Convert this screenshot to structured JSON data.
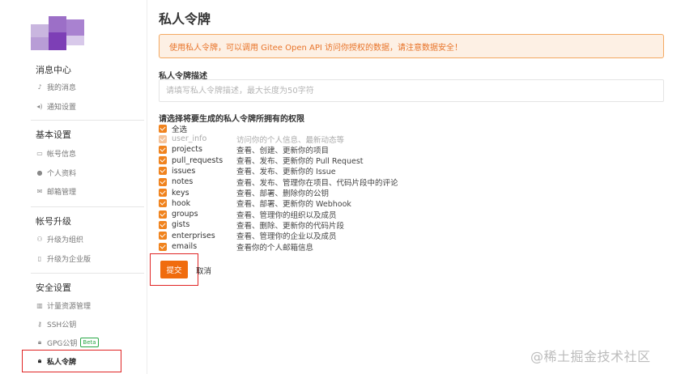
{
  "page_title": "私人令牌",
  "notice_text": "使用私人令牌，可以调用 Gitee Open API 访问你授权的数据，请注意数据安全！",
  "description": {
    "label": "私人令牌描述",
    "placeholder": "请填写私人令牌描述，最大长度为50字符",
    "value": ""
  },
  "permissions_label": "请选择将要生成的私人令牌所拥有的权限",
  "select_all_label": "全选",
  "permissions": [
    {
      "name": "user_info",
      "desc": "访问你的个人信息、最新动态等",
      "checked": true,
      "disabled": true
    },
    {
      "name": "projects",
      "desc": "查看、创建、更新你的项目",
      "checked": true,
      "disabled": false
    },
    {
      "name": "pull_requests",
      "desc": "查看、发布、更新你的 Pull Request",
      "checked": true,
      "disabled": false
    },
    {
      "name": "issues",
      "desc": "查看、发布、更新你的 Issue",
      "checked": true,
      "disabled": false
    },
    {
      "name": "notes",
      "desc": "查看、发布、管理你在项目、代码片段中的评论",
      "checked": true,
      "disabled": false
    },
    {
      "name": "keys",
      "desc": "查看、部署、删除你的公钥",
      "checked": true,
      "disabled": false
    },
    {
      "name": "hook",
      "desc": "查看、部署、更新你的 Webhook",
      "checked": true,
      "disabled": false
    },
    {
      "name": "groups",
      "desc": "查看、管理你的组织以及成员",
      "checked": true,
      "disabled": false
    },
    {
      "name": "gists",
      "desc": "查看、删除、更新你的代码片段",
      "checked": true,
      "disabled": false
    },
    {
      "name": "enterprises",
      "desc": "查看、管理你的企业以及成员",
      "checked": true,
      "disabled": false
    },
    {
      "name": "emails",
      "desc": "查看你的个人邮箱信息",
      "checked": true,
      "disabled": false
    }
  ],
  "buttons": {
    "submit": "提交",
    "cancel": "取消"
  },
  "sidebar": {
    "sections": [
      {
        "title": "消息中心",
        "items": [
          {
            "label": "我的消息",
            "icon": "bell-icon"
          },
          {
            "label": "通知设置",
            "icon": "speaker-icon"
          }
        ]
      },
      {
        "title": "基本设置",
        "items": [
          {
            "label": "帐号信息",
            "icon": "id-card-icon"
          },
          {
            "label": "个人资料",
            "icon": "user-icon"
          },
          {
            "label": "邮箱管理",
            "icon": "mail-icon"
          }
        ]
      },
      {
        "title": "帐号升级",
        "items": [
          {
            "label": "升级为组织",
            "icon": "group-icon"
          },
          {
            "label": "升级为企业版",
            "icon": "building-icon"
          }
        ]
      },
      {
        "title": "安全设置",
        "items": [
          {
            "label": "计量资源管理",
            "icon": "chart-icon"
          },
          {
            "label": "SSH公钥",
            "icon": "key-icon"
          },
          {
            "label": "GPG公钥",
            "icon": "lock-icon",
            "badge": "Beta"
          },
          {
            "label": "私人令牌",
            "icon": "lock-icon",
            "active": true
          }
        ]
      }
    ]
  },
  "watermark": "@稀土掘金技术社区",
  "colors": {
    "accent": "#f06c0e",
    "notice_bg": "#fdf0e4",
    "notice_border": "#f4a962",
    "highlight_box": "#e02424"
  }
}
